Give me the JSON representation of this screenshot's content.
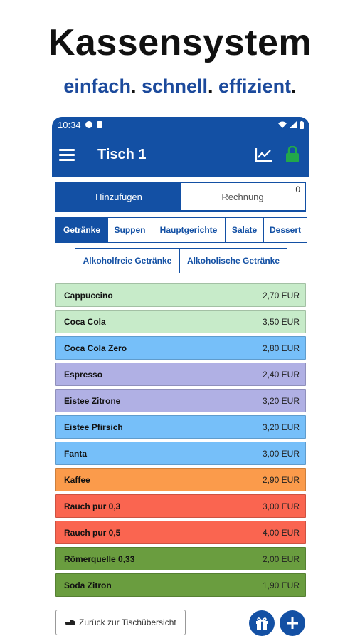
{
  "hero": {
    "title": "Kassensystem",
    "sub1": "einfach",
    "sub2": "schnell",
    "sub3": "effizient",
    "dot": "."
  },
  "status": {
    "time": "10:34"
  },
  "appbar": {
    "title": "Tisch 1"
  },
  "segment": {
    "add": "Hinzufügen",
    "bill": "Rechnung",
    "bill_count": "0"
  },
  "categories": [
    "Getränke",
    "Suppen",
    "Hauptgerichte",
    "Salate",
    "Dessert"
  ],
  "subcategories": [
    "Alkoholfreie Getränke",
    "Alkoholische Getränke"
  ],
  "items": [
    {
      "name": "Cappuccino",
      "price": "2,70 EUR",
      "color": "#c7ebc9"
    },
    {
      "name": "Coca Cola",
      "price": "3,50 EUR",
      "color": "#c7ebc9"
    },
    {
      "name": "Coca Cola Zero",
      "price": "2,80 EUR",
      "color": "#76bff9"
    },
    {
      "name": "Espresso",
      "price": "2,40 EUR",
      "color": "#b0b0e4"
    },
    {
      "name": "Eistee Zitrone",
      "price": "3,20 EUR",
      "color": "#b0b0e4"
    },
    {
      "name": "Eistee Pfirsich",
      "price": "3,20 EUR",
      "color": "#76bff9"
    },
    {
      "name": "Fanta",
      "price": "3,00 EUR",
      "color": "#76bff9"
    },
    {
      "name": "Kaffee",
      "price": "2,90 EUR",
      "color": "#fb9b4b"
    },
    {
      "name": "Rauch pur 0,3",
      "price": "3,00 EUR",
      "color": "#fa6550"
    },
    {
      "name": "Rauch pur 0,5",
      "price": "4,00 EUR",
      "color": "#fa6550"
    },
    {
      "name": "Römerquelle 0,33",
      "price": "2,00 EUR",
      "color": "#6a9d3f"
    },
    {
      "name": "Soda Zitron",
      "price": "1,90 EUR",
      "color": "#6a9d3f"
    }
  ],
  "footer": {
    "back": "Zurück zur Tischübersicht"
  },
  "colors": {
    "primary": "#1350a4",
    "lock": "#22a84a"
  },
  "icons": [
    "menu-icon",
    "chart-icon",
    "lock-icon",
    "hand-pointer-icon",
    "gift-icon",
    "plus-icon"
  ]
}
